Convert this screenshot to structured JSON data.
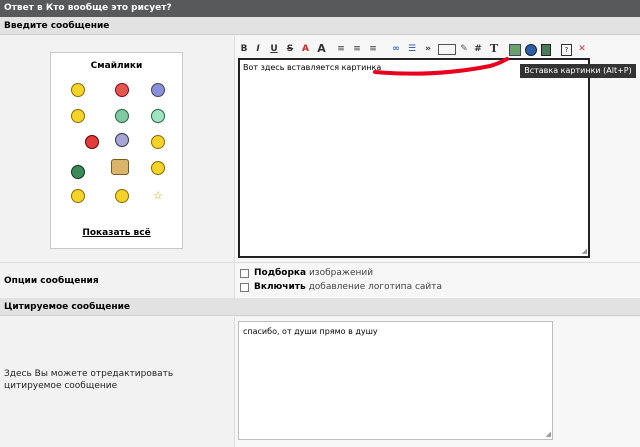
{
  "window": {
    "title": "Ответ в Кто вообще это рисует?"
  },
  "sections": {
    "message": "Введите сообщение",
    "options": "Опции сообщения",
    "quoted": "Цитируемое сообщение"
  },
  "smilies": {
    "title": "Смайлики",
    "show_all": "Показать всё"
  },
  "toolbar": {
    "bold": "B",
    "italic": "I",
    "underline": "U",
    "strike": "S",
    "color": "A",
    "size": "A",
    "hash": "#",
    "text": "T",
    "quote": "»"
  },
  "editor": {
    "value": "Вот здесь вставляется картинка"
  },
  "tooltip": {
    "text": "Вставка картинки (Alt+P)"
  },
  "options": {
    "opt1_bold": "Подборка",
    "opt1_rest": "изображений",
    "opt2_bold": "Включить",
    "opt2_rest": "добавление логотипа сайта"
  },
  "quote": {
    "label": "Здесь Вы можете отредактировать цитируемое сообщение",
    "value": "спасибо, от души прямо в душу"
  },
  "colors": {
    "titlebar": "#58595b",
    "annotation": "#e8001c"
  }
}
